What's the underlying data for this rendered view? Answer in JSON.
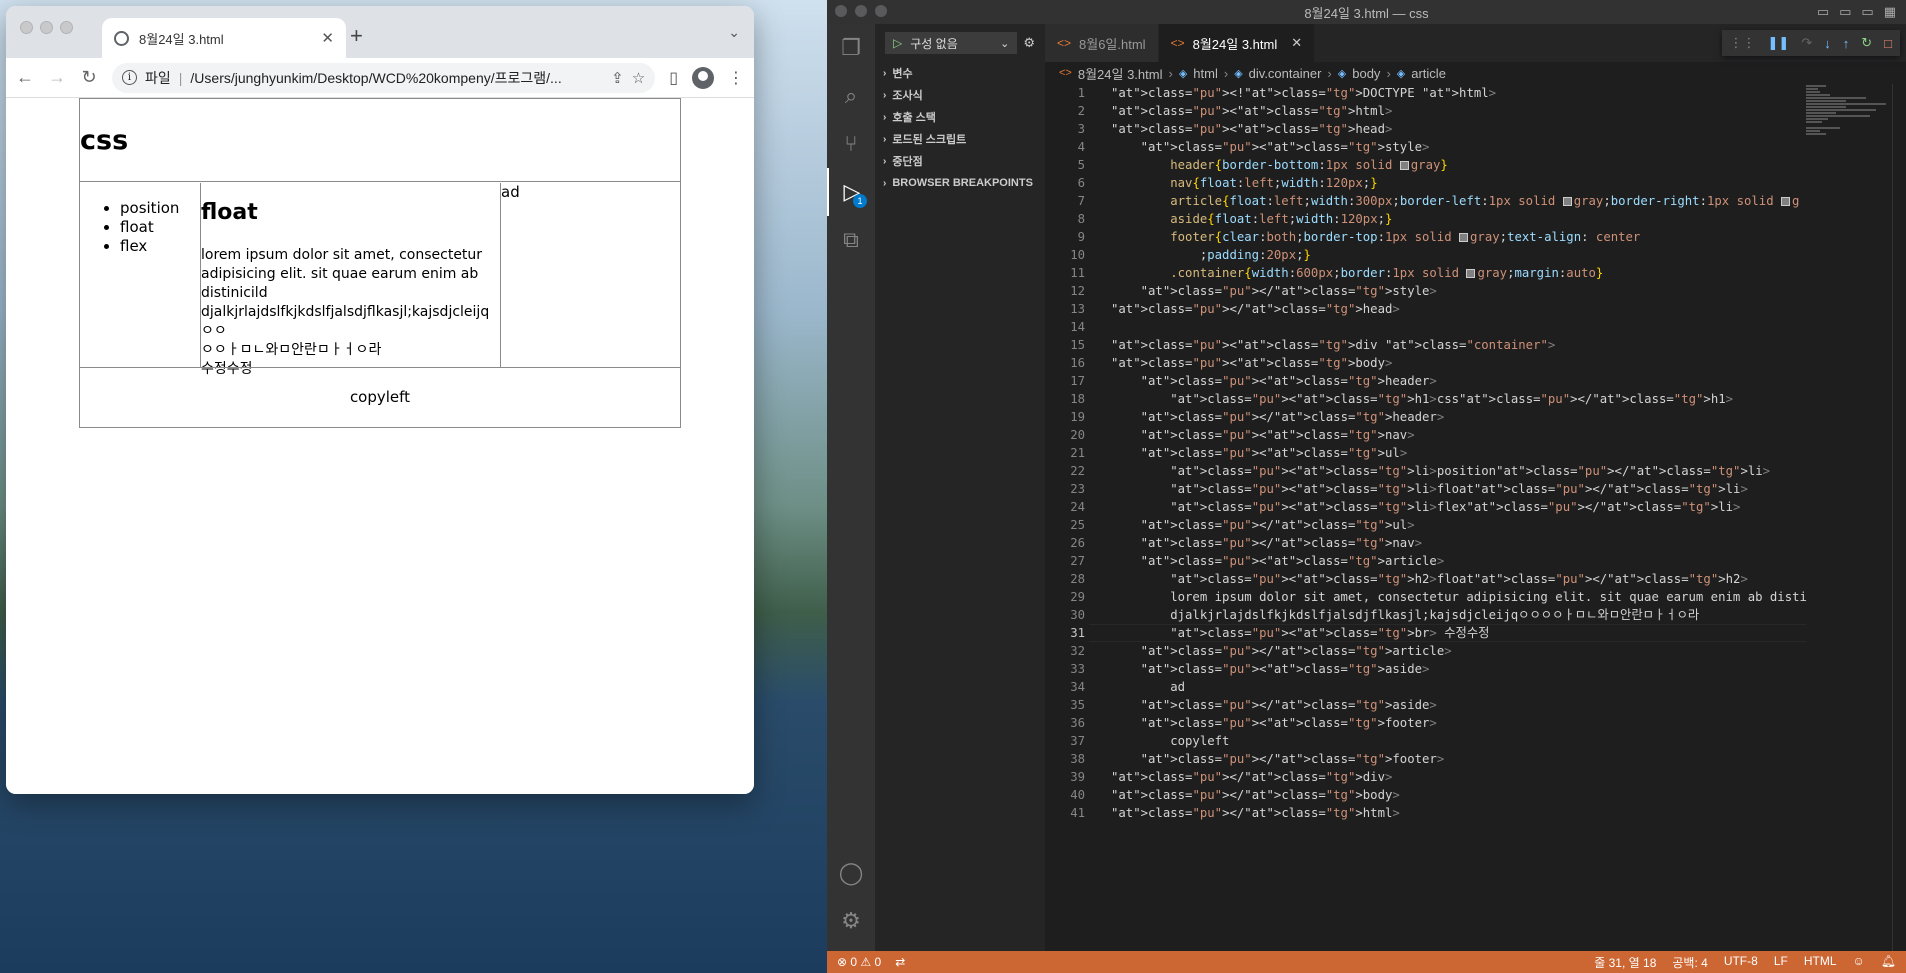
{
  "browser": {
    "tab_title": "8월24일 3.html",
    "address_scheme_label": "파일",
    "address_url": "/Users/junghyunkim/Desktop/WCD%20kompeny/프로그램/..."
  },
  "rendered_page": {
    "h1": "css",
    "nav_items": [
      "position",
      "float",
      "flex"
    ],
    "h2": "float",
    "article_lines": [
      "lorem ipsum dolor sit amet, consectetur",
      "adipisicing elit. sit quae earum enim ab",
      "distinicild",
      "djalkjrlajdslfkjkdslfjalsdjflkasjl;kajsdjcleijqㅇㅇ",
      "ㅇㅇㅏㅁㄴ와ㅁ안란ㅁㅏㅓㅇ라",
      "수정수정"
    ],
    "aside": "ad",
    "footer": "copyleft"
  },
  "vscode": {
    "window_title": "8월24일 3.html — css",
    "run_config": "구성 없음",
    "sections": [
      "변수",
      "조사식",
      "호출 스택",
      "로드된 스크립트",
      "중단점",
      "BROWSER BREAKPOINTS"
    ],
    "debug_badge": "1",
    "tabs": [
      "8월6일.html",
      "8월24일 3.html"
    ],
    "breadcrumb": [
      "8월24일 3.html",
      "html",
      "div.container",
      "body",
      "article"
    ],
    "current_line": 31,
    "status": {
      "problems": "0",
      "warnings": "0",
      "cursor": "줄 31, 열 18",
      "indent": "공백: 4",
      "encoding": "UTF-8",
      "eol": "LF",
      "language": "HTML"
    },
    "code_lines": [
      "<!DOCTYPE html>",
      "<html>",
      "<head>",
      "    <style>",
      "        header{border-bottom:1px solid gray}",
      "        nav{float:left;width:120px;}",
      "        article{float:left;width:300px;border-left:1px solid gray;border-right:1px solid g",
      "        aside{float:left;width:120px;}",
      "        footer{clear:both;border-top:1px solid gray;text-align: center",
      "            ;padding:20px;}",
      "        .container{width:600px;border:1px solid gray;margin:auto}",
      "    </style>",
      "</head>",
      "",
      "<div class=\"container\">",
      "<body>",
      "    <header>",
      "        <h1>css</h1>",
      "    </header>",
      "    <nav>",
      "    <ul>",
      "        <li>position</li>",
      "        <li>float</li>",
      "        <li>flex</li>",
      "    </ul>",
      "    </nav>",
      "    <article>",
      "        <h2>float</h2>",
      "        lorem ipsum dolor sit amet, consectetur adipisicing elit. sit quae earum enim ab disti",
      "        djalkjrlajdslfkjkdslfjalsdjflkasjl;kajsdjcleijqㅇㅇㅇㅇㅏㅁㄴ와ㅁ안란ㅁㅏㅓㅇ라",
      "        <br> 수정수정",
      "    </article>",
      "    <aside>",
      "        ad",
      "    </aside>",
      "    <footer>",
      "        copyleft",
      "    </footer>",
      "</div>",
      "</body>",
      "</html>"
    ]
  }
}
